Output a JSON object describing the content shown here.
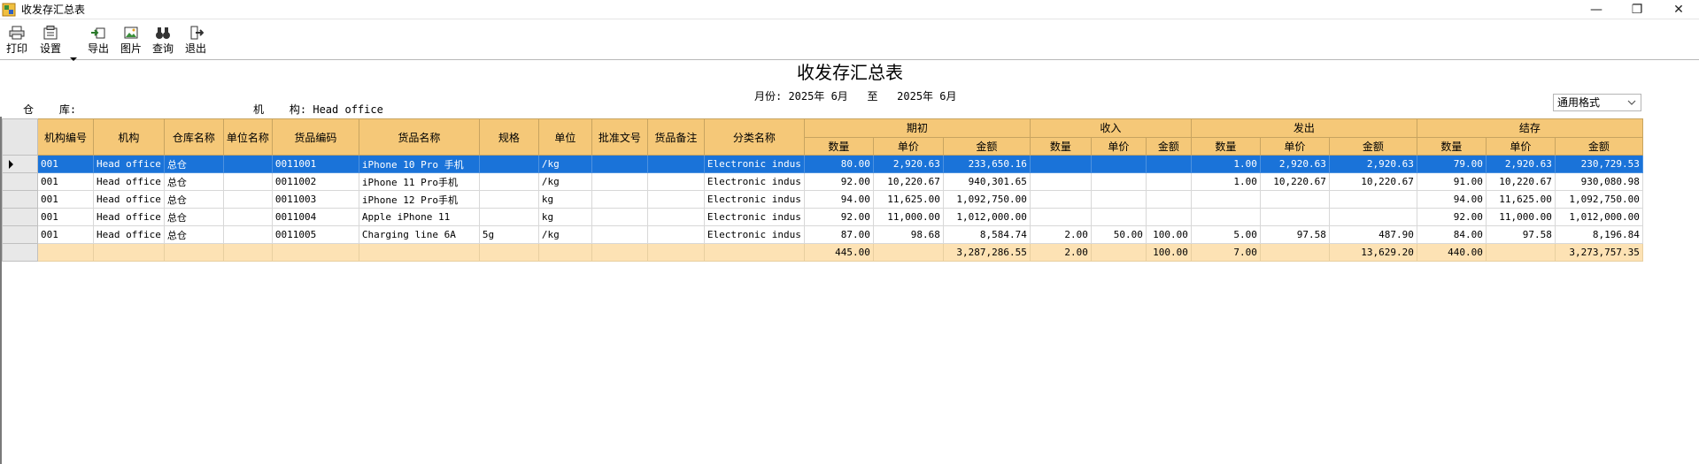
{
  "window": {
    "title": "收发存汇总表",
    "minimize": "—",
    "restore": "❐",
    "close": "✕"
  },
  "toolbar": {
    "print": "打印",
    "settings": "设置",
    "export": "导出",
    "picture": "图片",
    "query": "查询",
    "exit": "退出"
  },
  "report": {
    "title": "收发存汇总表",
    "month_line": "月份: 2025年 6月   至   2025年 6月",
    "warehouse_label": "仓    库:",
    "org_label": "机    构: Head office",
    "format_selected": "通用格式"
  },
  "grid": {
    "headers": {
      "org_code": "机构编号",
      "org": "机构",
      "warehouse": "仓库名称",
      "unit_name": "单位名称",
      "goods_code": "货品编码",
      "goods_name": "货品名称",
      "spec": "规格",
      "unit": "单位",
      "approval": "批准文号",
      "remark": "货品备注",
      "category": "分类名称",
      "opening": "期初",
      "income": "收入",
      "outgo": "发出",
      "closing": "结存",
      "qty": "数量",
      "price": "单价",
      "amount": "金额"
    },
    "rows": [
      [
        "001",
        "Head office",
        "总仓",
        "",
        "0011001",
        "iPhone 10  Pro 手机",
        "",
        "/kg",
        "",
        "",
        "Electronic indus",
        "80.00",
        "2,920.63",
        "233,650.16",
        "",
        "",
        "",
        "1.00",
        "2,920.63",
        "2,920.63",
        "79.00",
        "2,920.63",
        "230,729.53"
      ],
      [
        "001",
        "Head office",
        "总仓",
        "",
        "0011002",
        "iPhone 11 Pro手机",
        "",
        "/kg",
        "",
        "",
        "Electronic indus",
        "92.00",
        "10,220.67",
        "940,301.65",
        "",
        "",
        "",
        "1.00",
        "10,220.67",
        "10,220.67",
        "91.00",
        "10,220.67",
        "930,080.98"
      ],
      [
        "001",
        "Head office",
        "总仓",
        "",
        "0011003",
        "iPhone 12 Pro手机",
        "",
        "kg",
        "",
        "",
        "Electronic indus",
        "94.00",
        "11,625.00",
        "1,092,750.00",
        "",
        "",
        "",
        "",
        "",
        "",
        "94.00",
        "11,625.00",
        "1,092,750.00"
      ],
      [
        "001",
        "Head office",
        "总仓",
        "",
        "0011004",
        "Apple iPhone 11",
        "",
        "kg",
        "",
        "",
        "Electronic indus",
        "92.00",
        "11,000.00",
        "1,012,000.00",
        "",
        "",
        "",
        "",
        "",
        "",
        "92.00",
        "11,000.00",
        "1,012,000.00"
      ],
      [
        "001",
        "Head office",
        "总仓",
        "",
        "0011005",
        "Charging line 6A",
        "5g",
        "/kg",
        "",
        "",
        "Electronic indus",
        "87.00",
        "98.68",
        "8,584.74",
        "2.00",
        "50.00",
        "100.00",
        "5.00",
        "97.58",
        "487.90",
        "84.00",
        "97.58",
        "8,196.84"
      ]
    ],
    "total": [
      "",
      "",
      "",
      "",
      "",
      "",
      "",
      "",
      "",
      "",
      "",
      "445.00",
      "",
      "3,287,286.55",
      "2.00",
      "",
      "100.00",
      "7.00",
      "",
      "13,629.20",
      "440.00",
      "",
      "3,273,757.35"
    ]
  },
  "colors": {
    "header": "#f5c878",
    "selected": "#1a73d9",
    "total": "#fde2b4"
  }
}
